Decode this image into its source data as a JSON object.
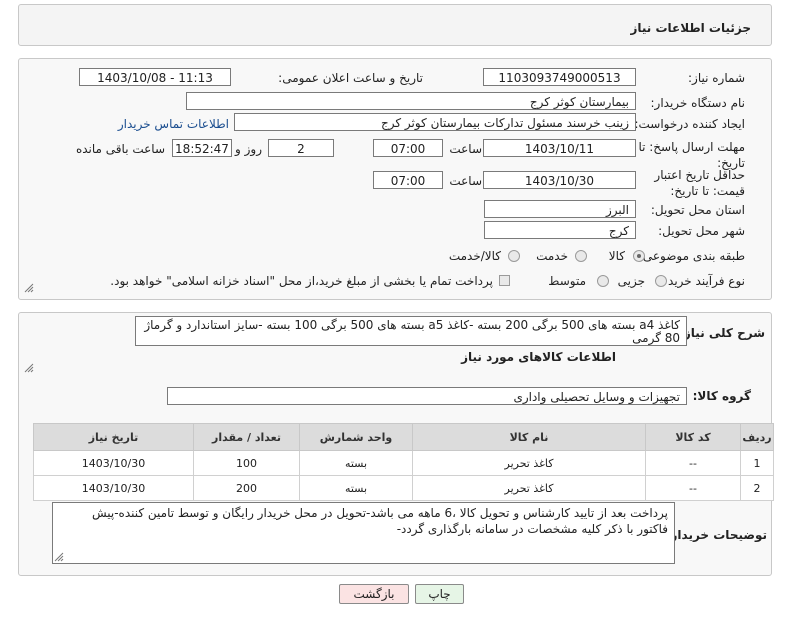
{
  "header": {
    "title": "جزئیات اطلاعات نیاز"
  },
  "form": {
    "need_number_label": "شماره نیاز:",
    "need_number": "1103093749000513",
    "announce_label": "تاریخ و ساعت اعلان عمومی:",
    "announce_value": "1403/10/08 - 11:13",
    "buyer_org_label": "نام دستگاه خریدار:",
    "buyer_org": "بیمارستان کوثر کرج",
    "creator_label": "ایجاد کننده درخواست:",
    "creator": "زینب خرسند مسئول تدارکات بیمارستان کوثر کرج",
    "contact_link": "اطلاعات تماس خریدار",
    "reply_deadline_label": "مهلت ارسال پاسخ: تا تاریخ:",
    "reply_date": "1403/10/11",
    "time_label": "ساعت",
    "reply_time": "07:00",
    "days_value": "2",
    "days_label": "روز و",
    "remaining_time": "18:52:47",
    "remaining_label": "ساعت باقی مانده",
    "validity_label": "حداقل تاریخ اعتبار قیمت: تا تاریخ:",
    "validity_date": "1403/10/30",
    "validity_time": "07:00",
    "province_label": "استان محل تحویل:",
    "province": "البرز",
    "city_label": "شهر محل تحویل:",
    "city": "کرج",
    "category_label": "طبقه بندی موضوعی:",
    "category_options": [
      "کالا",
      "خدمت",
      "کالا/خدمت"
    ],
    "purchase_type_label": "نوع فرآیند خرید :",
    "purchase_options": [
      "جزیی",
      "متوسط"
    ],
    "payment_note": "پرداخت تمام یا بخشی از مبلغ خرید،از محل \"اسناد خزانه اسلامی\" خواهد بود."
  },
  "details": {
    "general_desc_label": "شرح کلی نیاز:",
    "general_desc": "کاغذ a4 بسته های 500 برگی 200 بسته -کاغذ a5 بسته های 500 برگی 100 بسته -سایز استاندارد و گرماژ 80 گرمی",
    "goods_info_title": "اطلاعات کالاهای مورد نیاز",
    "goods_group_label": "گروه کالا:",
    "goods_group": "تجهیزات و وسایل تحصیلی واداری",
    "table": {
      "headers": [
        "ردیف",
        "کد کالا",
        "نام کالا",
        "واحد شمارش",
        "تعداد / مقدار",
        "تاریخ نیاز"
      ],
      "rows": [
        [
          "1",
          "--",
          "کاغذ تحریر",
          "بسته",
          "100",
          "1403/10/30"
        ],
        [
          "2",
          "--",
          "کاغذ تحریر",
          "بسته",
          "200",
          "1403/10/30"
        ]
      ]
    },
    "buyer_notes_label": "توضیحات خریدار:",
    "buyer_notes": "پرداخت بعد از تایید کارشناس و تحویل کالا ،6 ماهه می باشد-تحویل در محل خریدار رایگان و توسط تامین کننده-پیش فاکتور با ذکر کلیه مشخصات در سامانه بارگذاری گردد-"
  },
  "buttons": {
    "print": "چاپ",
    "back": "بازگشت"
  },
  "colors": {
    "print_bg": "#e6f5e6",
    "back_bg": "#fbe3e3"
  }
}
